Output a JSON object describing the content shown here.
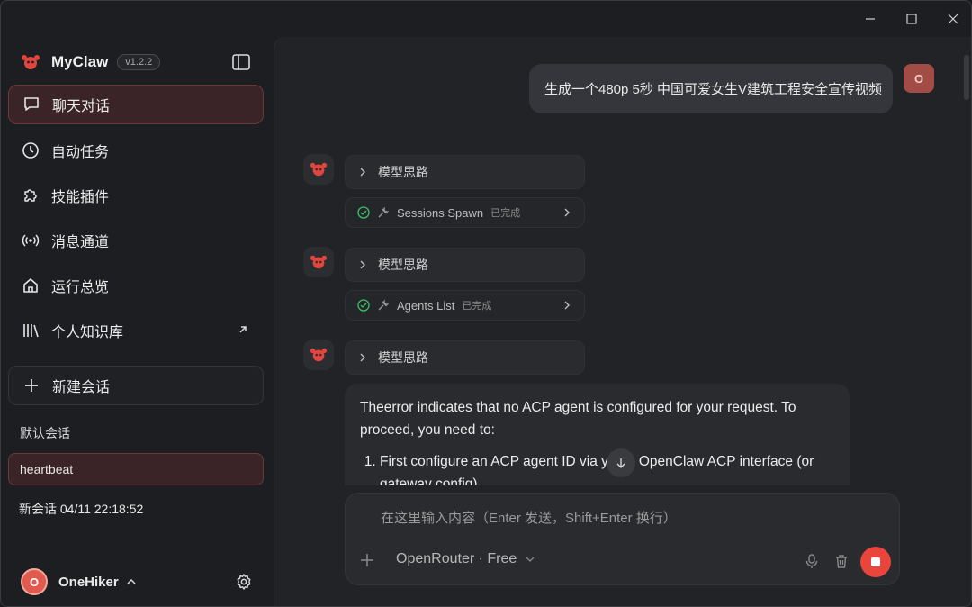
{
  "app": {
    "name": "MyClaw",
    "version": "v1.2.2"
  },
  "window_controls": {
    "minimize": "—",
    "maximize": "☐",
    "close": "✕"
  },
  "sidebar": {
    "nav_items": [
      {
        "label": "聊天对话",
        "icon": "chat-bubble-icon",
        "active": true
      },
      {
        "label": "自动任务",
        "icon": "clock-icon",
        "active": false
      },
      {
        "label": "技能插件",
        "icon": "puzzle-icon",
        "active": false
      },
      {
        "label": "消息通道",
        "icon": "broadcast-icon",
        "active": false
      },
      {
        "label": "运行总览",
        "icon": "home-icon",
        "active": false
      },
      {
        "label": "个人知识库",
        "icon": "library-icon",
        "active": false,
        "external": true
      }
    ],
    "new_chat_label": "新建会话",
    "section_title": "默认会话",
    "sessions": [
      {
        "label": "heartbeat",
        "active": true
      },
      {
        "label": "新会话 04/11 22:18:52",
        "active": false
      }
    ],
    "user": {
      "initial": "O",
      "name": "OneHiker"
    }
  },
  "chat": {
    "user_message": "生成一个480p 5秒 中国可爱女生V建筑工程安全宣传视频",
    "user_initial": "O",
    "thinking_label": "模型思路",
    "tool_calls": [
      {
        "name": "Sessions Spawn",
        "status": "已完成"
      },
      {
        "name": "Agents List",
        "status": "已完成"
      }
    ],
    "answer": {
      "paragraph": "Theerror indicates that no ACP agent is configured for your request. To proceed, you need to:",
      "list_item_1_a": "First configure an ACP agent ID via y",
      "list_item_1_b": "OpenClaw ACP interface (or gateway config)"
    }
  },
  "composer": {
    "placeholder": "在这里输入内容（Enter 发送，Shift+Enter 换行）",
    "model": "OpenRouter · Free"
  },
  "colors": {
    "accent": "#e8453c",
    "active_bg": "#3a2427",
    "success": "#3cc06a"
  }
}
